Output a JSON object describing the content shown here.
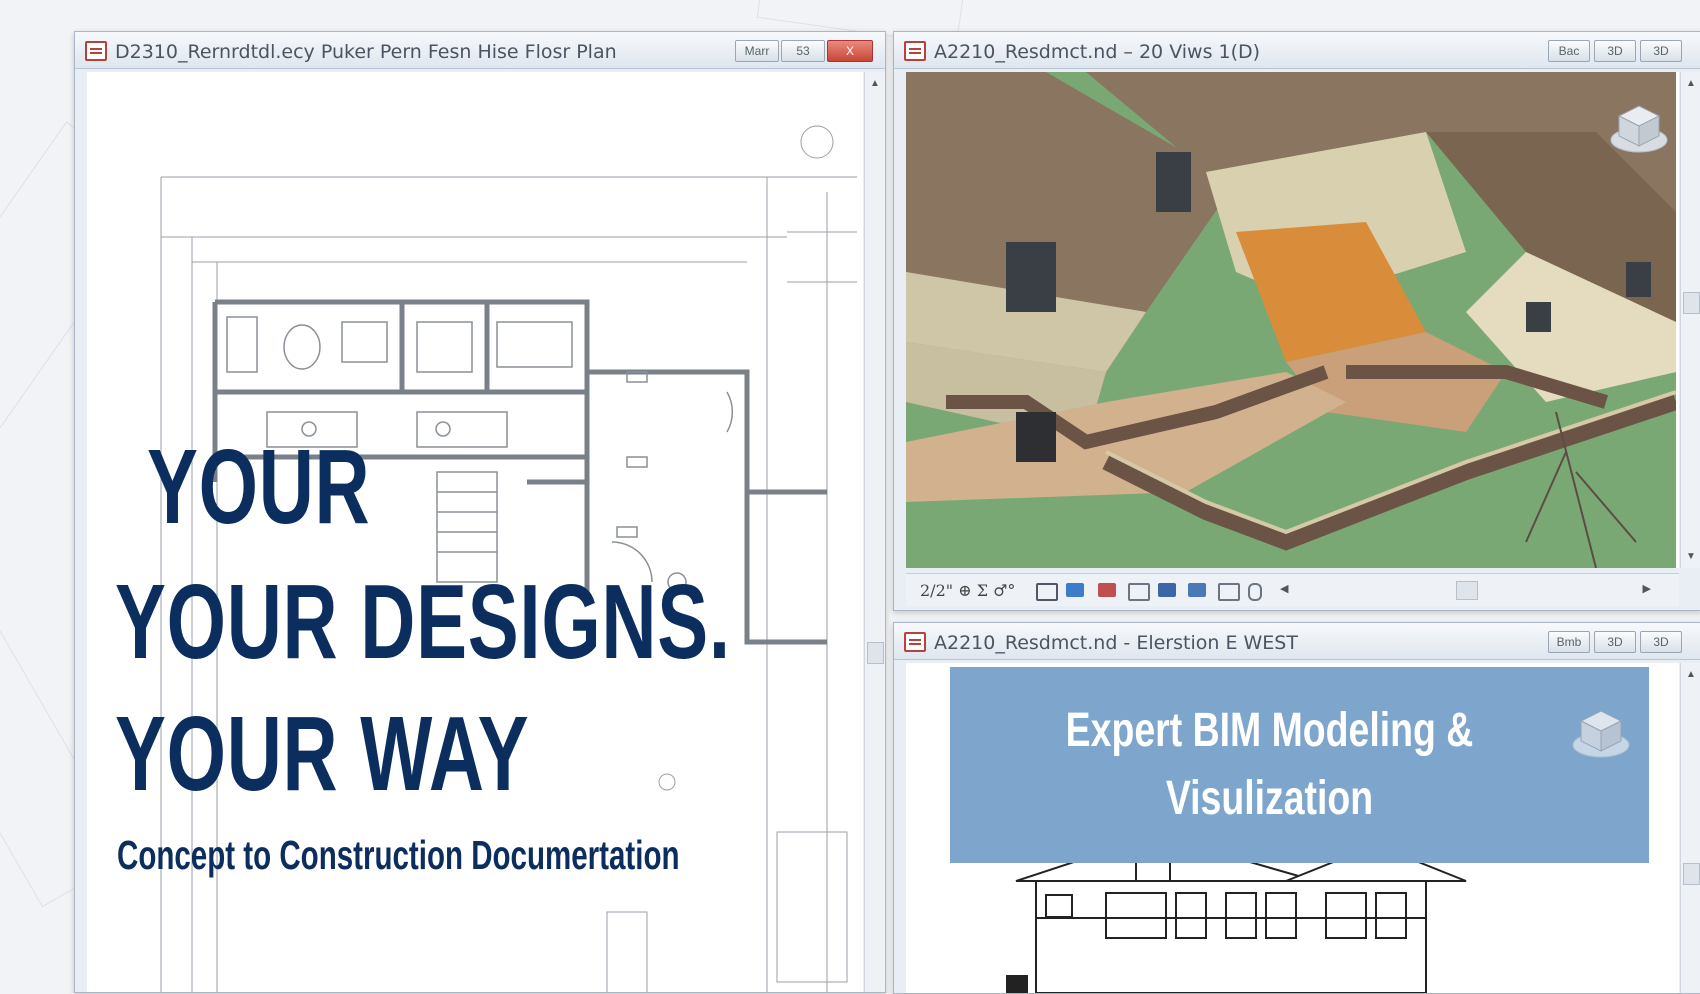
{
  "windows": {
    "floor_plan": {
      "title": "D2310_Rernrdtdl.ecy Puker Pern Fesn Hise Flosr Plan",
      "buttons": [
        "Marr",
        "53",
        "X"
      ]
    },
    "view_3d": {
      "title": "A2210_Resdmct.nd – 20 Viws 1(D)",
      "buttons": [
        "Bac",
        "3D",
        "3D"
      ],
      "status": "2/2\" ⊕ Σ ♂°"
    },
    "elevation": {
      "title": "A2210_Resdmct.nd - Elerstion E WEST",
      "buttons": [
        "Bmb",
        "3D",
        "3D"
      ],
      "banner_line1": "Expert BIM Modeling &",
      "banner_line2": "Visulization"
    }
  },
  "hero": {
    "line1": "YOUR",
    "line2": "YOUR DESIGNS.",
    "line3": "YOUR WAY",
    "tagline": "Concept to Construction Documertation"
  },
  "colors": {
    "hero_text": "#0c2e5e",
    "lawn": "#7aa874",
    "roof": "#8a7560",
    "banner": "#7ea6cc"
  }
}
